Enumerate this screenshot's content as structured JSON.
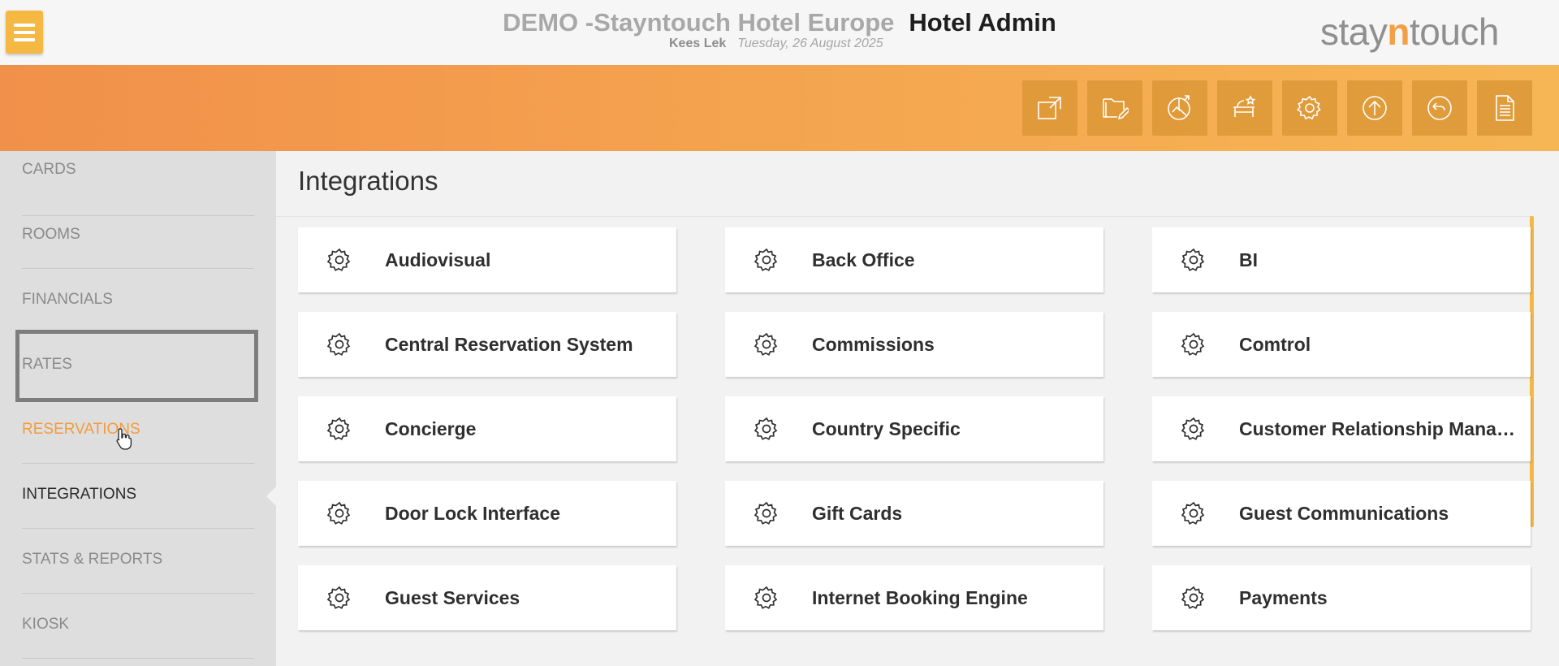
{
  "header": {
    "hotel_name": "DEMO -Stayntouch Hotel Europe",
    "section_title": "Hotel Admin",
    "user_name": "Kees Lek",
    "date": "Tuesday, 26 August 2025",
    "logo": {
      "pre": "stay",
      "accent": "n",
      "post": "touch"
    }
  },
  "colors": {
    "accent": "#f39c3c",
    "menu_button": "#f5b843",
    "band_start": "#f1904a",
    "band_end": "#f6b656"
  },
  "toolbar": [
    {
      "icon": "open-external-icon"
    },
    {
      "icon": "folder-edit-icon"
    },
    {
      "icon": "chart-upload-icon"
    },
    {
      "icon": "room-service-icon"
    },
    {
      "icon": "settings-icon"
    },
    {
      "icon": "upload-icon"
    },
    {
      "icon": "history-icon"
    },
    {
      "icon": "document-icon"
    }
  ],
  "sidebar": {
    "items": [
      {
        "label": "CARDS",
        "state": "normal"
      },
      {
        "label": "ROOMS",
        "state": "normal"
      },
      {
        "label": "FINANCIALS",
        "state": "normal"
      },
      {
        "label": "RATES",
        "state": "focused"
      },
      {
        "label": "RESERVATIONS",
        "state": "hover"
      },
      {
        "label": "INTEGRATIONS",
        "state": "selected"
      },
      {
        "label": "STATS & REPORTS",
        "state": "normal"
      },
      {
        "label": "KIOSK",
        "state": "normal"
      }
    ]
  },
  "main": {
    "title": "Integrations",
    "cards": [
      {
        "label": "Audiovisual",
        "icon": "gear-icon"
      },
      {
        "label": "Back Office",
        "icon": "gear-icon"
      },
      {
        "label": "BI",
        "icon": "gear-icon"
      },
      {
        "label": "Central Reservation System",
        "icon": "gear-icon"
      },
      {
        "label": "Commissions",
        "icon": "gear-icon"
      },
      {
        "label": "Comtrol",
        "icon": "gear-icon"
      },
      {
        "label": "Concierge",
        "icon": "gear-icon"
      },
      {
        "label": "Country Specific",
        "icon": "gear-icon"
      },
      {
        "label": "Customer Relationship Manag…",
        "icon": "gear-icon"
      },
      {
        "label": "Door Lock Interface",
        "icon": "gear-icon"
      },
      {
        "label": "Gift Cards",
        "icon": "gear-icon"
      },
      {
        "label": "Guest Communications",
        "icon": "gear-icon"
      },
      {
        "label": "Guest Services",
        "icon": "gear-icon"
      },
      {
        "label": "Internet Booking Engine",
        "icon": "gear-icon"
      },
      {
        "label": "Payments",
        "icon": "gear-icon"
      }
    ]
  }
}
